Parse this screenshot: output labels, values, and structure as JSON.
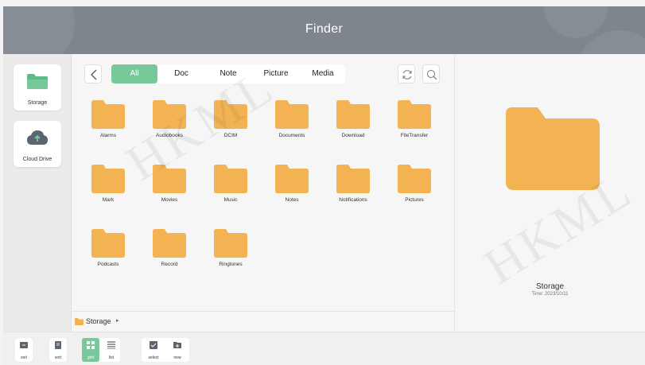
{
  "header": {
    "title": "Finder"
  },
  "sidebar": {
    "items": [
      {
        "label": "Storage",
        "icon": "storage-folder-icon"
      },
      {
        "label": "Cloud Drive",
        "icon": "cloud-upload-icon"
      }
    ]
  },
  "toolbar": {
    "tabs": [
      {
        "label": "All",
        "active": true
      },
      {
        "label": "Doc"
      },
      {
        "label": "Note"
      },
      {
        "label": "Picture"
      },
      {
        "label": "Media"
      }
    ]
  },
  "folders": [
    "Alarms",
    "Audiobooks",
    "DCIM",
    "Documents",
    "Download",
    "FileTransfer",
    "Mark",
    "Movies",
    "Music",
    "Notes",
    "Notifications",
    "Pictures",
    "Podcasts",
    "Record",
    "Ringtones"
  ],
  "breadcrumb": {
    "label": "Storage",
    "separator": "▸"
  },
  "detail": {
    "name": "Storage",
    "time": "Time: 2023/10/11"
  },
  "bottombar": {
    "buttons": [
      {
        "label": "exit",
        "icon": "exit-icon"
      },
      {
        "label": "sort",
        "icon": "sort-icon"
      },
      {
        "label": "grid",
        "icon": "grid-icon",
        "active": true
      },
      {
        "label": "list",
        "icon": "list-icon"
      },
      {
        "label": "select",
        "icon": "select-icon"
      },
      {
        "label": "new",
        "icon": "new-folder-icon"
      }
    ]
  },
  "watermark": "HKML",
  "colors": {
    "accent": "#77c99b",
    "folder": "#f3b353",
    "header": "#7e858c"
  }
}
